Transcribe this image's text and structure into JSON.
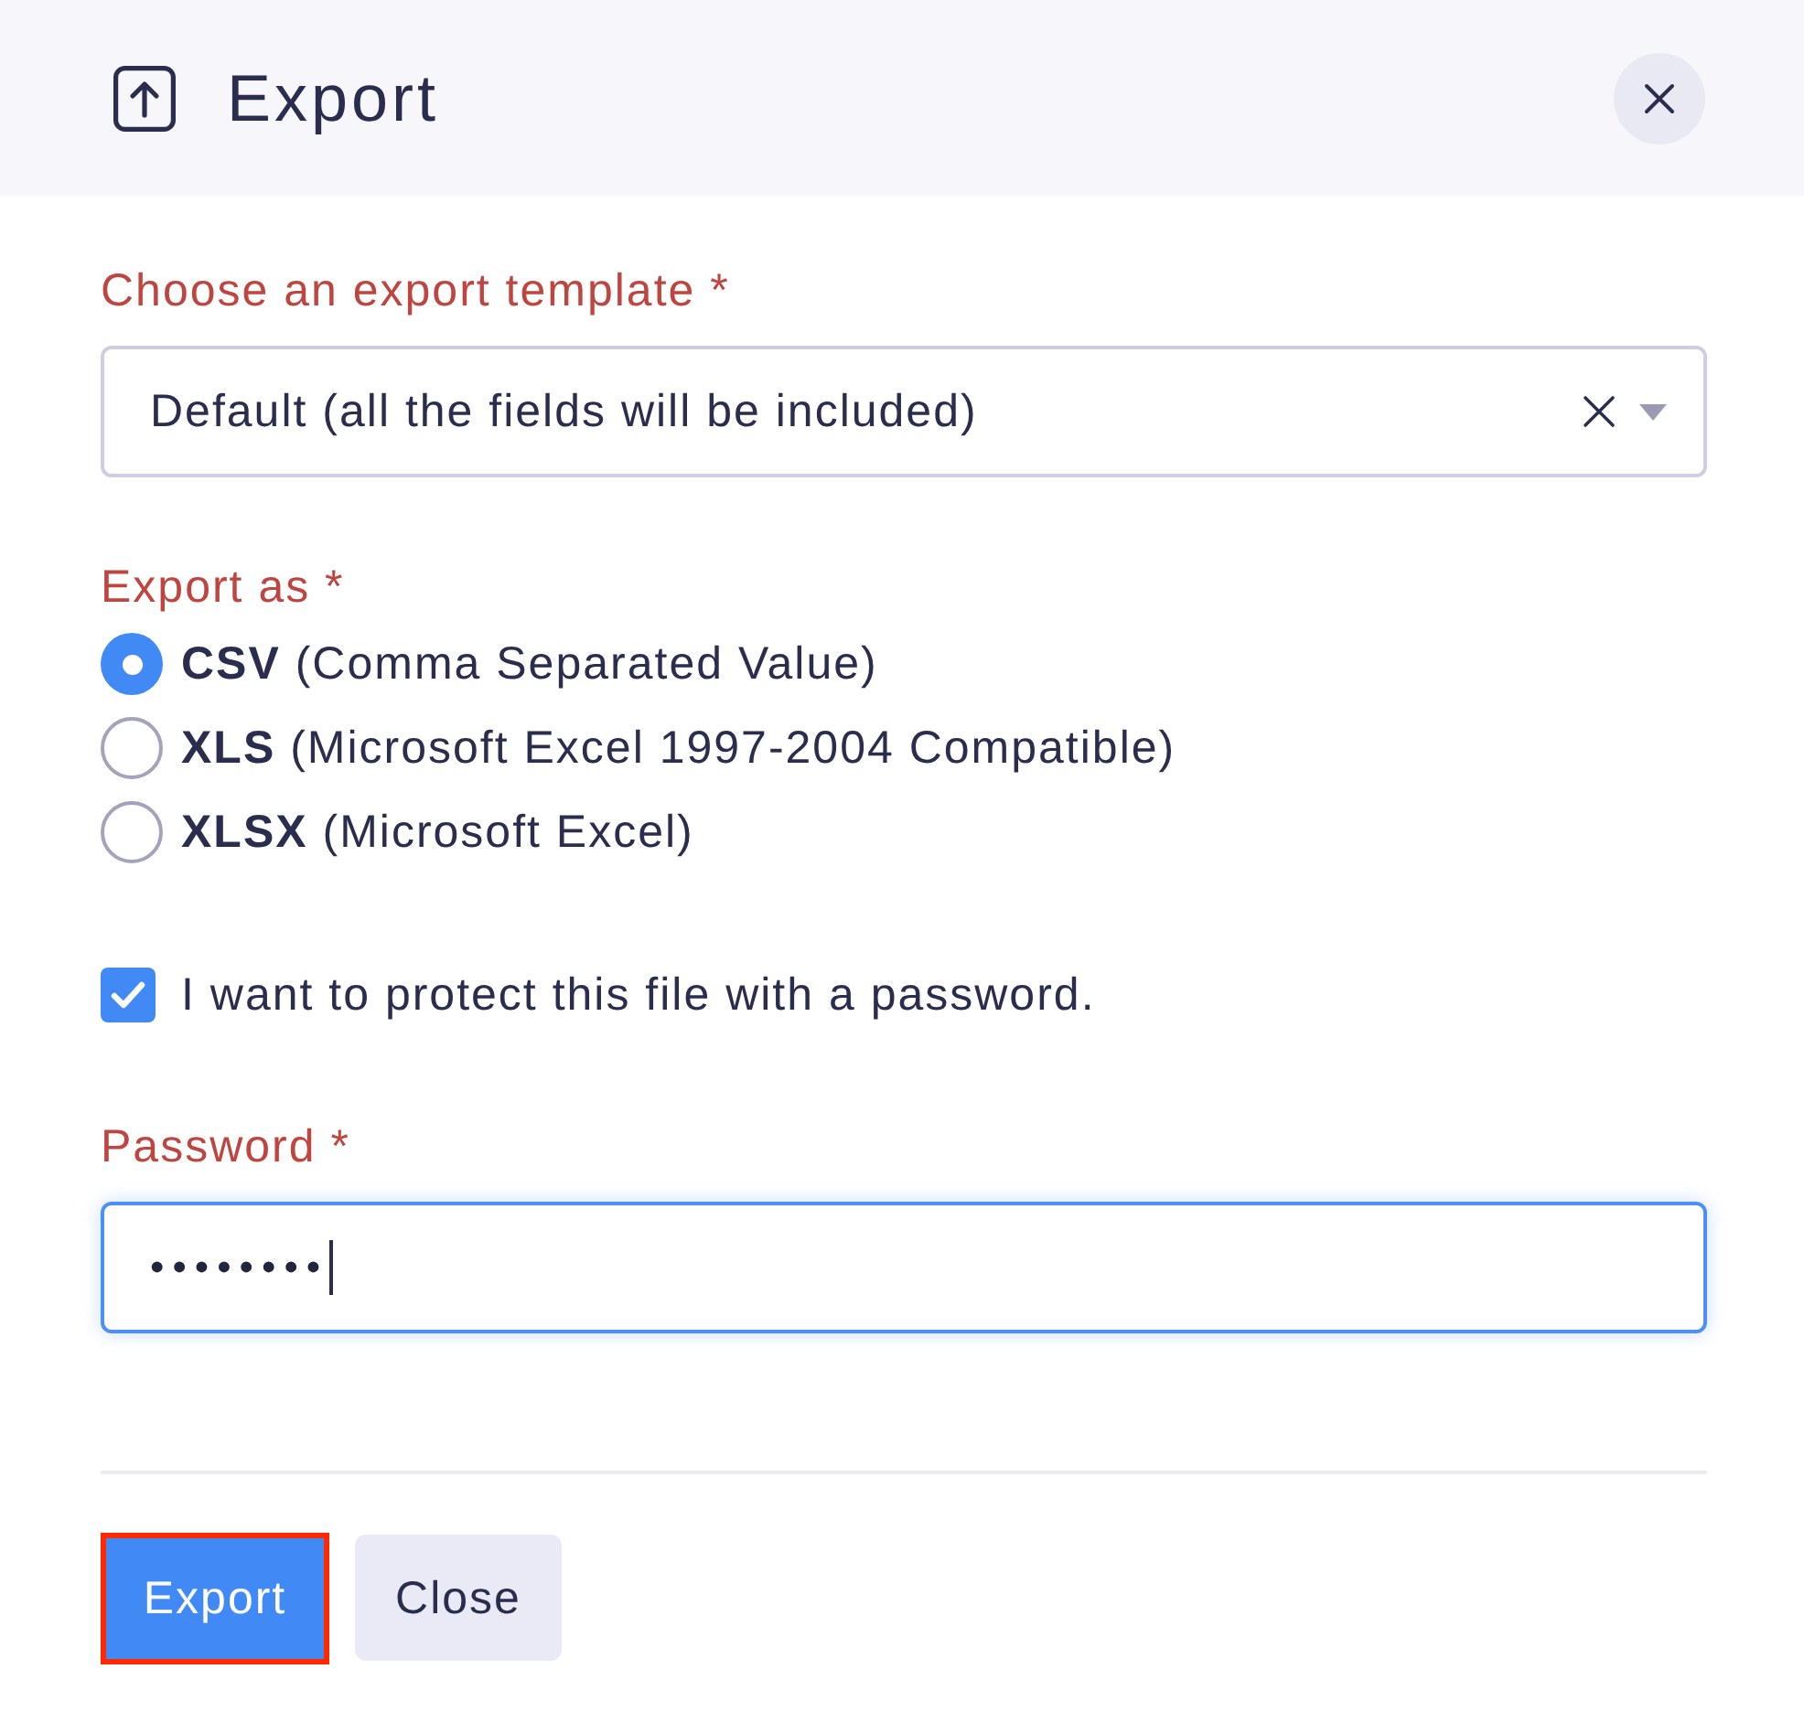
{
  "dialog": {
    "title": "Export"
  },
  "template_field": {
    "label": "Choose an export template *",
    "value": "Default (all the fields will be included)"
  },
  "export_format": {
    "label": "Export as *",
    "options": [
      {
        "label": "**CSV** (Comma Separated Value)",
        "selected": true
      },
      {
        "label": "**XLS** (Microsoft Excel 1997-2004 Compatible)",
        "selected": false
      },
      {
        "label": "**XLSX** (Microsoft Excel)",
        "selected": false
      }
    ]
  },
  "protect_checkbox": {
    "label": "I want to protect this file with a password.",
    "checked": true
  },
  "password_field": {
    "label": "Password *",
    "value": "••••••••",
    "focused": true
  },
  "buttons": [
    {
      "label": "Export",
      "kind": "primary",
      "highlighted": true
    },
    {
      "label": "Close",
      "kind": "secondary",
      "highlighted": false
    }
  ]
}
